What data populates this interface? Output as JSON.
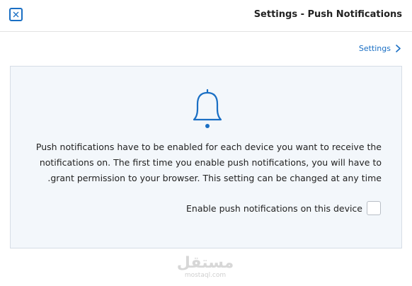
{
  "header": {
    "title": "Settings - Push Notifications",
    "close_icon": "close-icon"
  },
  "breadcrumb": {
    "label": "Settings",
    "icon": "chevron-right-icon"
  },
  "panel": {
    "icon": "bell-icon",
    "description_lines": [
      "Push notifications have to be enabled for each device you want to receive the",
      "notifications on. The first time you enable push notifications, you will have to",
      ".grant permission to your browser. This setting can be changed at any time"
    ],
    "enable_label": "Enable push notifications on this device",
    "enable_checked": false
  },
  "watermark": {
    "logo_text": "مستقل",
    "sub_text": "mostaql.com"
  },
  "colors": {
    "accent": "#1a6fc4",
    "panel_bg": "#f3f7fb",
    "panel_border": "#d6dde6"
  }
}
